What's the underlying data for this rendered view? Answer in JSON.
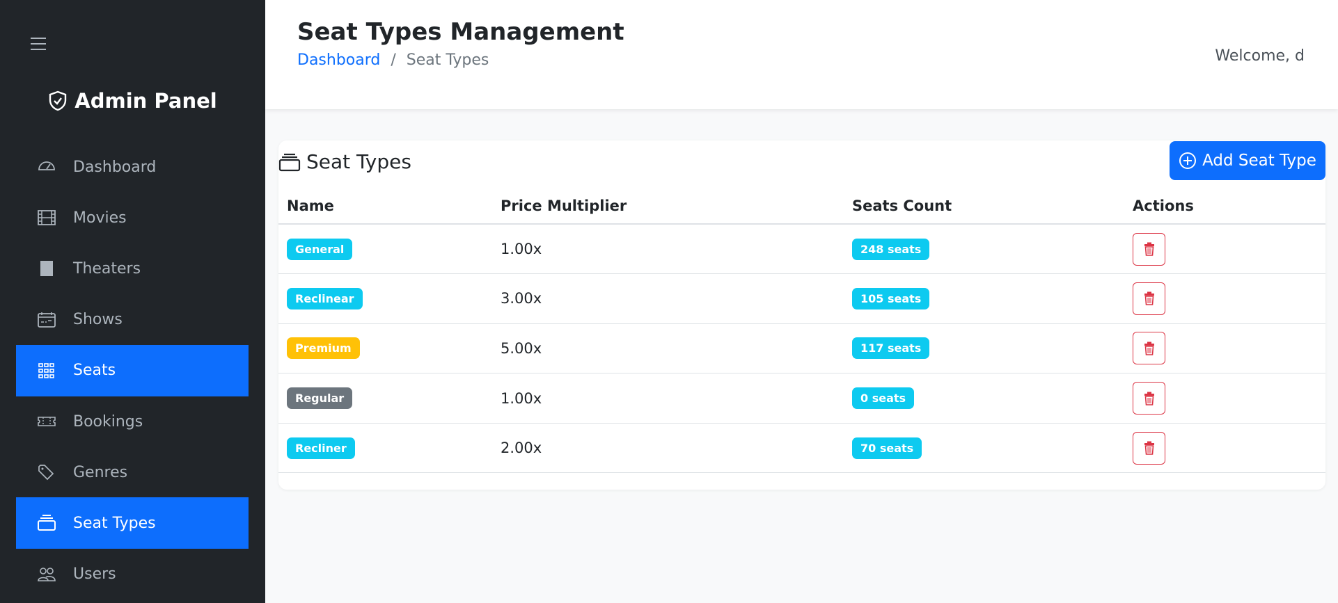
{
  "sidebar": {
    "brand": "Admin Panel",
    "items": [
      {
        "label": "Dashboard",
        "icon": "speedometer-icon",
        "active": false
      },
      {
        "label": "Movies",
        "icon": "film-icon",
        "active": false
      },
      {
        "label": "Theaters",
        "icon": "square-icon",
        "active": false
      },
      {
        "label": "Shows",
        "icon": "calendar-icon",
        "active": false
      },
      {
        "label": "Seats",
        "icon": "grid-icon",
        "active": true
      },
      {
        "label": "Bookings",
        "icon": "ticket-icon",
        "active": false
      },
      {
        "label": "Genres",
        "icon": "tags-icon",
        "active": false
      },
      {
        "label": "Seat Types",
        "icon": "stack-icon",
        "active": true
      },
      {
        "label": "Users",
        "icon": "people-icon",
        "active": false
      }
    ]
  },
  "header": {
    "title": "Seat Types Management",
    "breadcrumb": {
      "home": "Dashboard",
      "sep": "/",
      "current": "Seat Types"
    },
    "welcome": "Welcome, d"
  },
  "card": {
    "title": "Seat Types",
    "add_label": "Add Seat Type",
    "columns": [
      "Name",
      "Price Multiplier",
      "Seats Count",
      "Actions"
    ],
    "rows": [
      {
        "name": "General",
        "color": "#0dcaf0",
        "multiplier": "1.00x",
        "seats": "248 seats"
      },
      {
        "name": "Reclinear",
        "color": "#0dcaf0",
        "multiplier": "3.00x",
        "seats": "105 seats"
      },
      {
        "name": "Premium",
        "color": "#ffc107",
        "multiplier": "5.00x",
        "seats": "117 seats"
      },
      {
        "name": "Regular",
        "color": "#6c757d",
        "multiplier": "1.00x",
        "seats": "0 seats"
      },
      {
        "name": "Recliner",
        "color": "#0dcaf0",
        "multiplier": "2.00x",
        "seats": "70 seats"
      }
    ]
  }
}
